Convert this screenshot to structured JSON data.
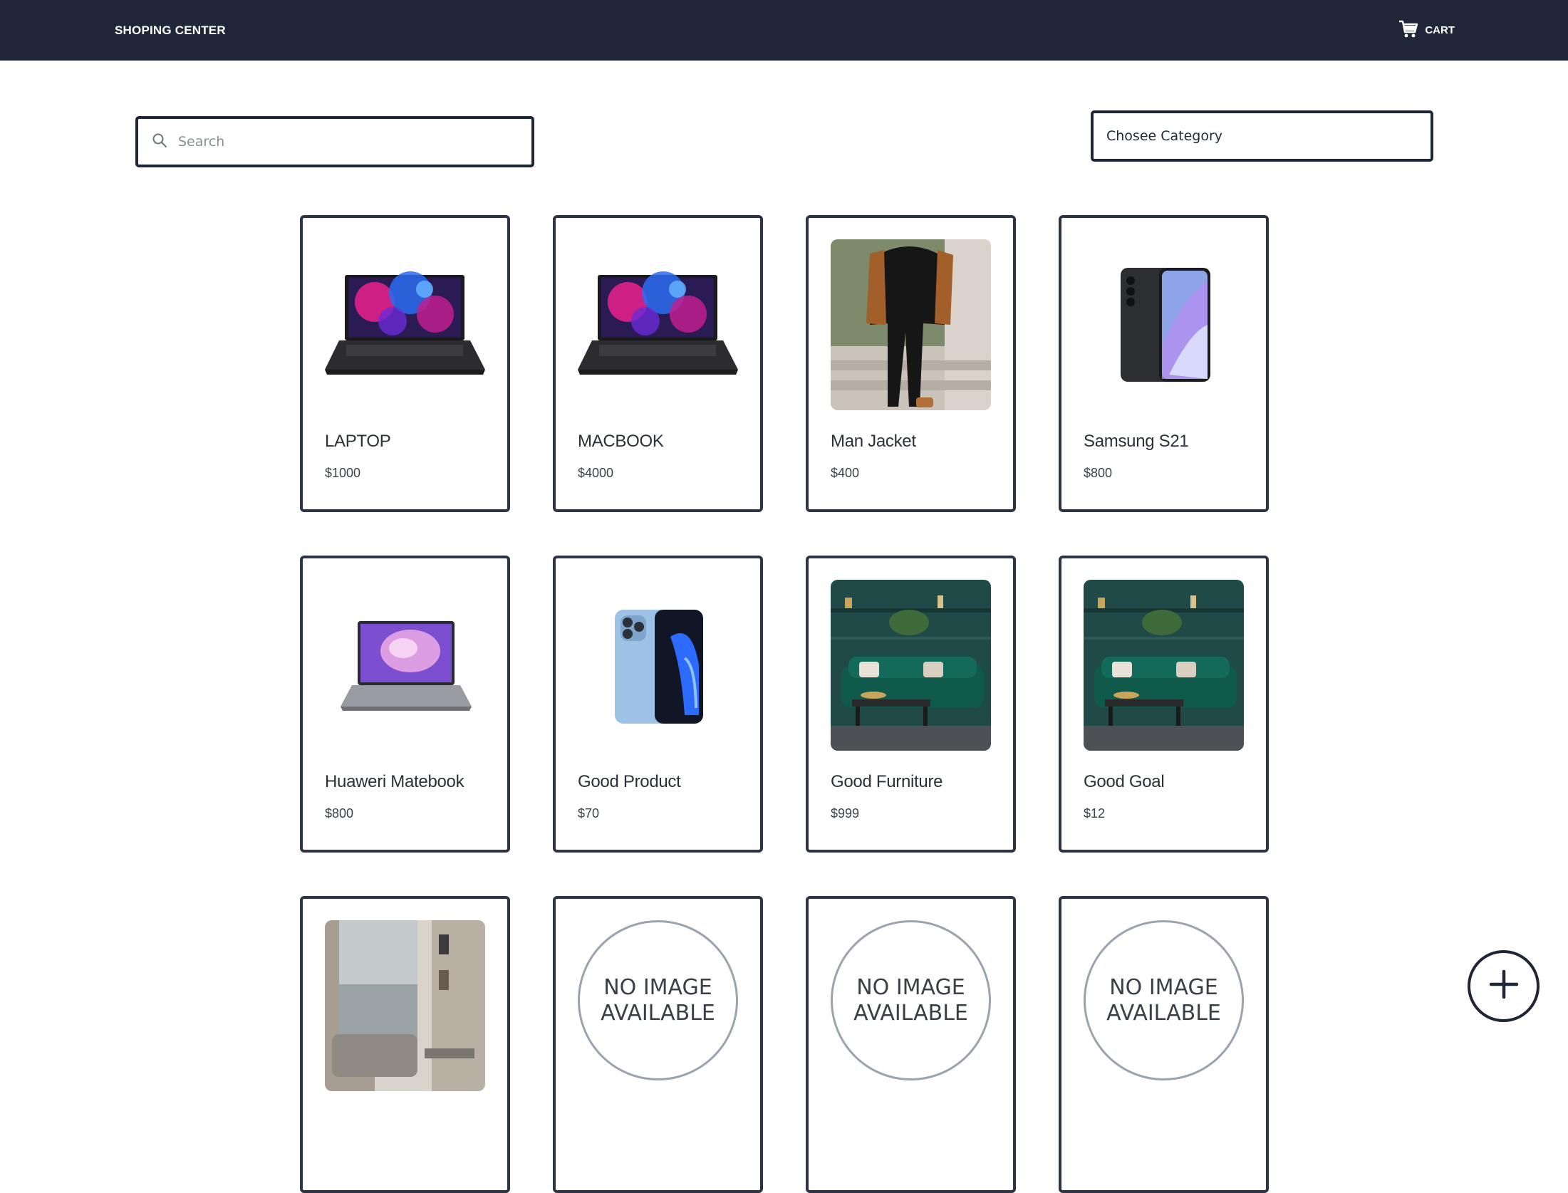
{
  "header": {
    "brand": "SHOPING CENTER",
    "cart_label": "CART",
    "cart_icon": "shopping-cart-icon"
  },
  "search": {
    "placeholder": "Search",
    "value": ""
  },
  "category": {
    "selected": "Chosee Category"
  },
  "products": [
    {
      "title": "LAPTOP",
      "price": "$1000",
      "image": "laptop"
    },
    {
      "title": "MACBOOK",
      "price": "$4000",
      "image": "laptop"
    },
    {
      "title": "Man Jacket",
      "price": "$400",
      "image": "jacket"
    },
    {
      "title": "Samsung S21",
      "price": "$800",
      "image": "phone"
    },
    {
      "title": "Huaweri Matebook",
      "price": "$800",
      "image": "matebook"
    },
    {
      "title": "Good Product",
      "price": "$70",
      "image": "iphone"
    },
    {
      "title": "Good Furniture",
      "price": "$999",
      "image": "sofa"
    },
    {
      "title": "Good Goal",
      "price": "$12",
      "image": "sofa"
    },
    {
      "title": "",
      "price": "",
      "image": "room"
    },
    {
      "title": "",
      "price": "",
      "image": "none"
    },
    {
      "title": "",
      "price": "",
      "image": "none"
    },
    {
      "title": "",
      "price": "",
      "image": "none"
    }
  ],
  "no_image": {
    "line1": "NO IMAGE",
    "line2": "AVAILABLE"
  },
  "fab": {
    "icon": "plus-icon"
  }
}
